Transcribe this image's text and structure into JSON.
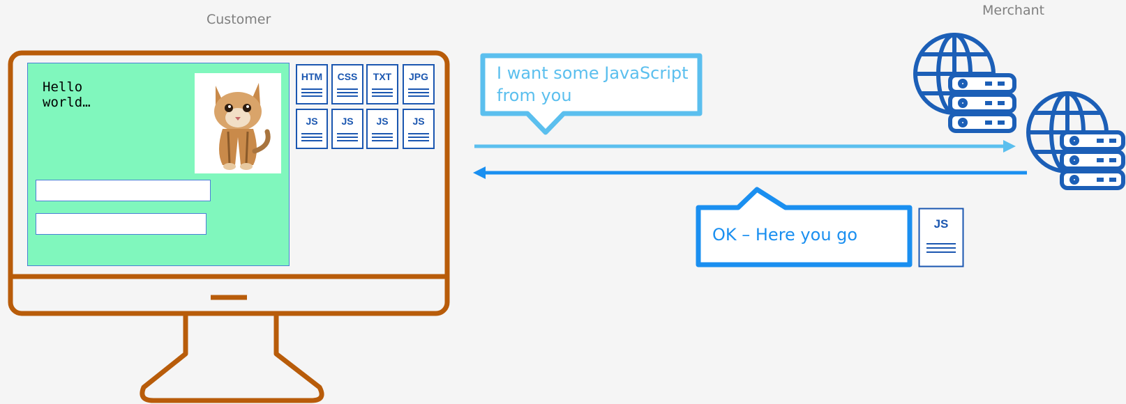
{
  "labels": {
    "customer": "Customer",
    "merchant": "Merchant"
  },
  "screen": {
    "hello_text": "Hello\nworld…"
  },
  "files": {
    "row1": [
      "HTM",
      "CSS",
      "TXT",
      "JPG"
    ],
    "row2": [
      "JS",
      "JS",
      "JS",
      "JS"
    ]
  },
  "request_bubble": {
    "text": "I want some JavaScript from you"
  },
  "response_bubble": {
    "text": "OK – Here you go",
    "attachment": "JS"
  },
  "icons": [
    "monitor-icon",
    "kitten-image",
    "globe-server-icon",
    "file-icon",
    "arrow-right-icon",
    "arrow-left-icon"
  ],
  "colors": {
    "monitor": "#b85c0a",
    "page_bg": "#80f7bd",
    "file_blue": "#1a56b0",
    "request_blue": "#5bbfee",
    "response_blue": "#1a8ff0",
    "server_blue": "#1c5fb7"
  }
}
